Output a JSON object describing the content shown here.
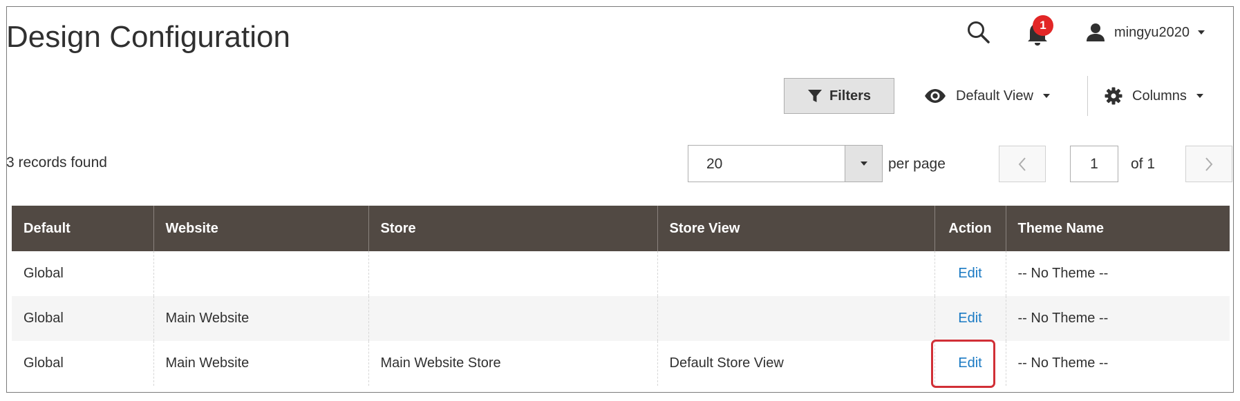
{
  "header": {
    "title": "Design Configuration",
    "notification_count": "1",
    "username": "mingyu2020"
  },
  "toolbar": {
    "filters_label": "Filters",
    "view_label": "Default View",
    "columns_label": "Columns"
  },
  "pagination": {
    "records_found": "3 records found",
    "per_page_value": "20",
    "per_page_label": "per page",
    "current_page": "1",
    "total_pages_label": "of 1"
  },
  "grid": {
    "columns": [
      "Default",
      "Website",
      "Store",
      "Store View",
      "Action",
      "Theme Name"
    ],
    "rows": [
      {
        "default": "Global",
        "website": "",
        "store": "",
        "store_view": "",
        "action": "Edit",
        "theme": "-- No Theme --"
      },
      {
        "default": "Global",
        "website": "Main Website",
        "store": "",
        "store_view": "",
        "action": "Edit",
        "theme": "-- No Theme --"
      },
      {
        "default": "Global",
        "website": "Main Website",
        "store": "Main Website Store",
        "store_view": "Default Store View",
        "action": "Edit",
        "theme": "-- No Theme --"
      }
    ]
  },
  "colors": {
    "header_bg": "#514943",
    "link": "#1979c3",
    "badge": "#e22626",
    "highlight": "#d12f36"
  },
  "icons": [
    "search-icon",
    "bell-icon",
    "user-icon",
    "funnel-icon",
    "eye-icon",
    "gear-icon",
    "chevron-left-icon",
    "chevron-right-icon"
  ]
}
